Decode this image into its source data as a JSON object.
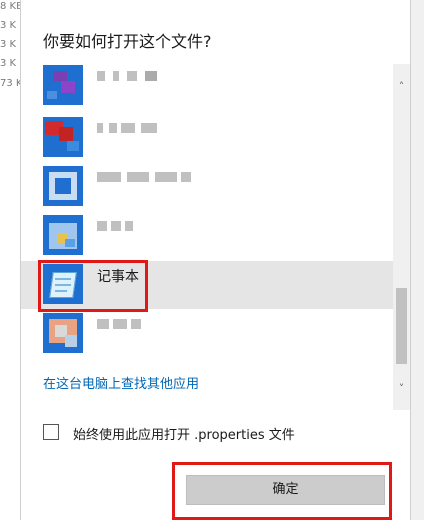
{
  "background": {
    "sizes": [
      "8 KB",
      "3 K",
      "3 K",
      "3 K",
      "73 K"
    ]
  },
  "dialog": {
    "title": "你要如何打开这个文件?",
    "apps": [
      {
        "label": "",
        "icon": "app-icon-obscured",
        "selected": false
      },
      {
        "label": "",
        "icon": "app-icon-obscured",
        "selected": false
      },
      {
        "label": "",
        "icon": "app-icon-obscured",
        "selected": false
      },
      {
        "label": "",
        "icon": "app-icon-obscured",
        "selected": false
      },
      {
        "label": "记事本",
        "icon": "notepad-icon",
        "selected": true
      },
      {
        "label": "",
        "icon": "app-icon-obscured",
        "selected": false
      }
    ],
    "more_apps_link": "在这台电脑上查找其他应用",
    "always_use_label": "始终使用此应用打开 .properties 文件",
    "always_use_checked": false,
    "ok_button": "确定",
    "scrollbar": {
      "up_arrow": "˄",
      "down_arrow": "˅"
    }
  },
  "colors": {
    "link": "#0066b4",
    "highlight": "#e01818",
    "selected_row": "#e5e5e5",
    "icon_blue": "#1f6fd1"
  }
}
